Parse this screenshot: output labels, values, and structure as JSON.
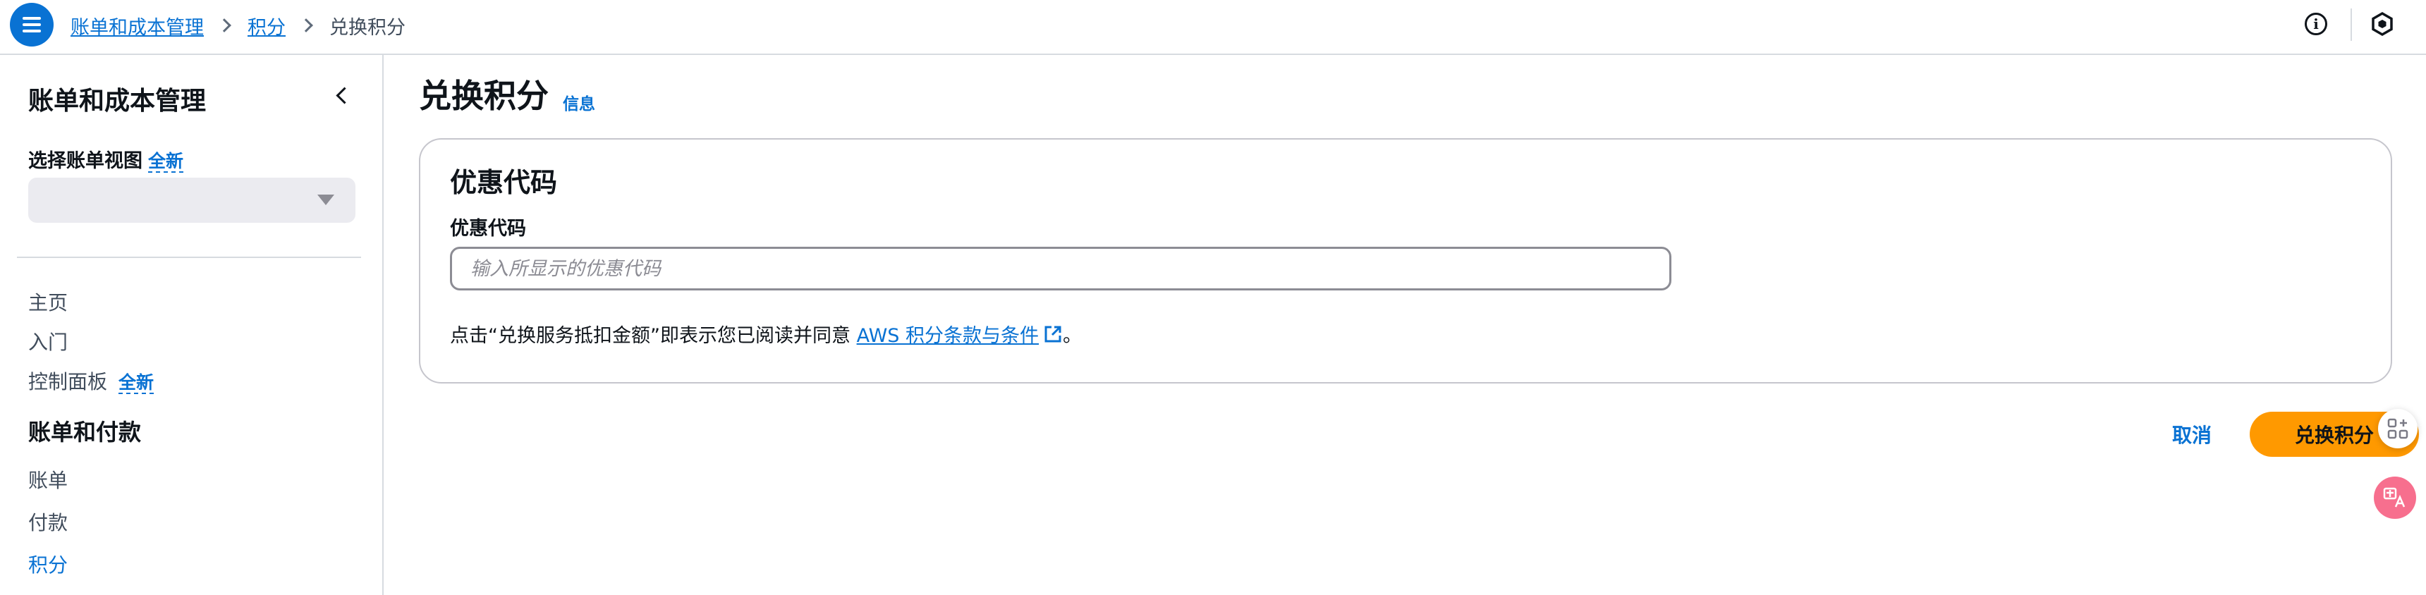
{
  "header": {
    "breadcrumb": {
      "items": [
        "账单和成本管理",
        "积分"
      ],
      "current": "兑换积分"
    }
  },
  "icons": {
    "menu": "hamburger-menu-icon",
    "info": "info-circle-icon",
    "profile": "hexagon-icon",
    "external": "external-link-icon",
    "collapse": "chevron-left-icon",
    "apps": "apps-plus-icon",
    "translate": "translate-icon"
  },
  "sidebar": {
    "title": "账单和成本管理",
    "view_label": "选择账单视图",
    "new_badge": "全新",
    "select_value": "",
    "items": [
      {
        "label": "主页"
      },
      {
        "label": "入门"
      },
      {
        "label": "控制面板",
        "badge": "全新"
      }
    ],
    "section": "账单和付款",
    "section_items": [
      {
        "label": "账单"
      },
      {
        "label": "付款"
      },
      {
        "label": "积分",
        "active": true
      }
    ]
  },
  "main": {
    "title": "兑换积分",
    "info_link": "信息",
    "card": {
      "title": "优惠代码",
      "field_label": "优惠代码",
      "input_value": "",
      "input_placeholder": "输入所显示的优惠代码",
      "terms_prefix": "点击“兑换服务抵扣金额”即表示您已阅读并同意 ",
      "terms_link": "AWS 积分条款与条件",
      "terms_suffix": "。"
    },
    "actions": {
      "cancel": "取消",
      "redeem": "兑换积分"
    }
  },
  "colors": {
    "link": "#0972d3",
    "primary_button": "#ff9900",
    "menu_button": "#0972d3",
    "translate_button": "#f76f8e"
  }
}
